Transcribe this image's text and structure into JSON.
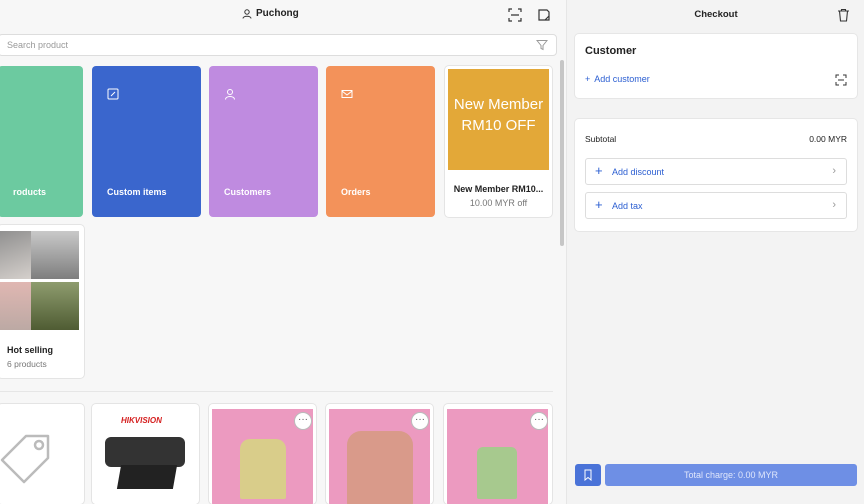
{
  "header": {
    "location": "Puchong",
    "search_placeholder": "Search product"
  },
  "tiles": [
    {
      "label": "roducts",
      "color": "#6ccaa0",
      "icon": "grid-icon"
    },
    {
      "label": "Custom items",
      "color": "#3a66cd",
      "icon": "edit-icon"
    },
    {
      "label": "Customers",
      "color": "#bf8be0",
      "icon": "person-icon"
    },
    {
      "label": "Orders",
      "color": "#f3925a",
      "icon": "envelope-icon"
    }
  ],
  "promo": {
    "image_text": "New Member RM10 OFF",
    "name": "New Member RM10...",
    "price": "10.00 MYR off",
    "color": "#e3a838"
  },
  "hot_selling": {
    "name": "Hot selling",
    "count": "6 products"
  },
  "products": [
    {
      "kind": "tag"
    },
    {
      "kind": "webcam",
      "brand": "HIKVISION"
    },
    {
      "kind": "vest",
      "menu": "···"
    },
    {
      "kind": "jacket",
      "menu": "···"
    },
    {
      "kind": "top",
      "menu": "···"
    }
  ],
  "checkout": {
    "title": "Checkout",
    "customer_title": "Customer",
    "add_customer": "Add customer",
    "subtotal_label": "Subtotal",
    "subtotal_value": "0.00 MYR",
    "add_discount": "Add discount",
    "add_tax": "Add tax",
    "total_charge": "Total charge: 0.00 MYR"
  },
  "colors": {
    "accent": "#2c5fd2",
    "primary_button": "#6e8fe5"
  }
}
